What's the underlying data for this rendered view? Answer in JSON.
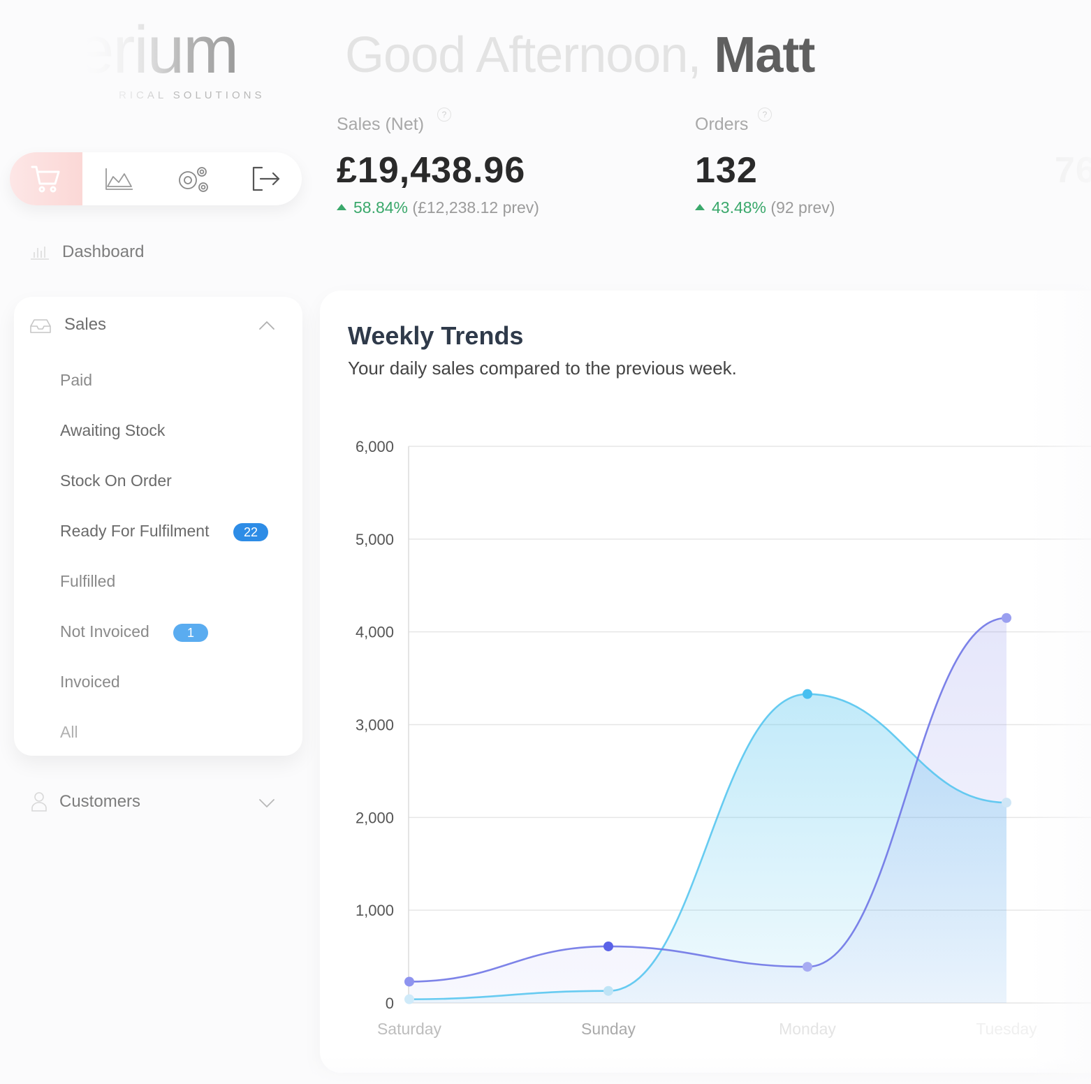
{
  "brand": {
    "logo_text": "erium",
    "tagline": "RICAL SOLUTIONS"
  },
  "greeting": {
    "prefix": "Good Afternoon,",
    "name": "Matt"
  },
  "toolbar": {
    "icons": [
      "cart-icon",
      "chart-icon",
      "settings-icon",
      "logout-icon"
    ]
  },
  "kpis": [
    {
      "label": "Sales (Net)",
      "help": "?",
      "value": "£19,438.96",
      "pct": "58.84%",
      "prev": "(£12,238.12 prev)"
    },
    {
      "label": "Orders",
      "help": "?",
      "value": "132",
      "pct": "43.48%",
      "prev": "(92 prev)"
    },
    {
      "value": "76"
    }
  ],
  "nav": {
    "dashboard": "Dashboard",
    "sales": "Sales",
    "sales_items": [
      {
        "label": "Paid"
      },
      {
        "label": "Awaiting Stock"
      },
      {
        "label": "Stock On Order"
      },
      {
        "label": "Ready For Fulfilment",
        "badge": "22"
      },
      {
        "label": "Fulfilled"
      },
      {
        "label": "Not Invoiced",
        "badge": "1"
      },
      {
        "label": "Invoiced"
      },
      {
        "label": "All"
      }
    ],
    "customers": "Customers"
  },
  "colors": {
    "accent_badge": "#2d8ce6",
    "badge_light": "#5aacf0",
    "positive": "#3aa86b",
    "series_current": "#4fc3ee",
    "series_previous": "#6f75e6"
  },
  "chart": {
    "title": "Weekly Trends",
    "subtitle": "Your daily sales compared to the previous week."
  },
  "chart_data": {
    "type": "area",
    "categories": [
      "Saturday",
      "Sunday",
      "Monday",
      "Tuesday"
    ],
    "y_ticks": [
      "6,000",
      "5,000",
      "4,000",
      "3,000",
      "2,000",
      "1,000",
      "0"
    ],
    "ylim": [
      0,
      6000
    ],
    "grid": true,
    "series": [
      {
        "values": [
          230,
          610,
          390,
          4150
        ]
      },
      {
        "values": [
          40,
          130,
          3330,
          2160
        ]
      }
    ]
  }
}
